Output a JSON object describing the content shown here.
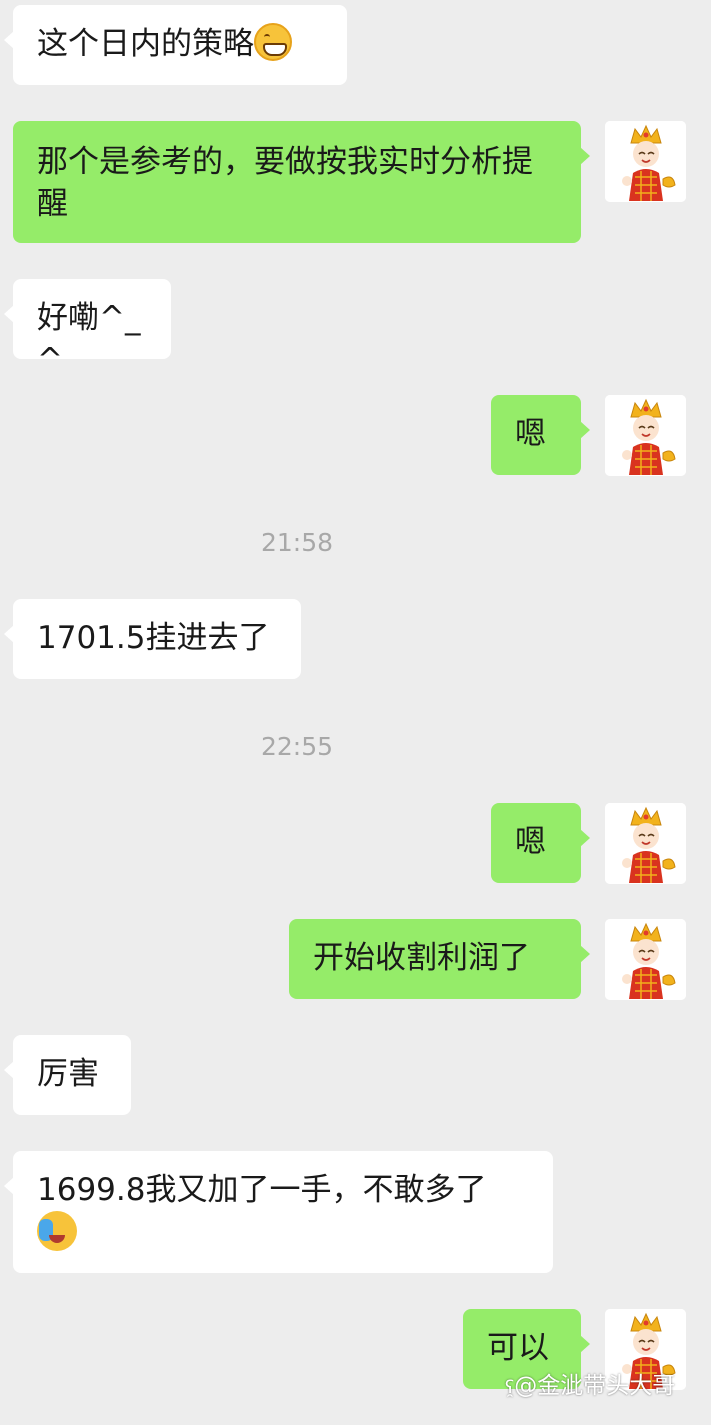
{
  "messages": [
    {
      "side": "in",
      "text": "这个日内的策略",
      "emoji": "grinning-squint-emoji"
    },
    {
      "side": "out",
      "text": "那个是参考的，要做按我实时分析提醒"
    },
    {
      "side": "in",
      "text": "好嘞^_^"
    },
    {
      "side": "out",
      "text": "嗯"
    },
    {
      "side": "in",
      "text": "1701.5挂进去了"
    },
    {
      "side": "out",
      "text": "嗯"
    },
    {
      "side": "out",
      "text": "开始收割利润了"
    },
    {
      "side": "in",
      "text": "厉害"
    },
    {
      "side": "in",
      "text": "1699.8我又加了一手，不敢多了",
      "emoji": "crying-emoji"
    },
    {
      "side": "out",
      "text": "可以"
    }
  ],
  "timestamps": [
    "21:58",
    "22:55"
  ],
  "avatar": {
    "icon": "tang-monk-cartoon-avatar",
    "label": "唐僧"
  },
  "watermark": {
    "text": "@金泚带头大哥",
    "icon": "weibo-icon"
  },
  "colors": {
    "background": "#ededed",
    "incoming": "#ffffff",
    "outgoing": "#95ec69",
    "timestamp": "#a8a8a8"
  }
}
